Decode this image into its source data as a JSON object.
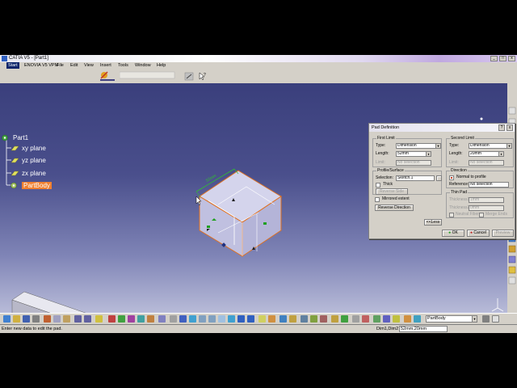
{
  "window": {
    "title": "CATIA V5 - [Part1]",
    "controls": [
      "_",
      "□",
      "x"
    ]
  },
  "menu": {
    "items": [
      "Start",
      "ENOVIA V5 VPM",
      "File",
      "Edit",
      "View",
      "Insert",
      "Tools",
      "Window",
      "Help"
    ]
  },
  "tree": {
    "root": "Part1",
    "planes": [
      "xy plane",
      "yz plane",
      "zx plane"
    ],
    "body": "PartBody"
  },
  "viewport": {
    "dimension_label": "52mm",
    "background_top": "#3a3f7c",
    "background_bottom": "#b8bbd8"
  },
  "dialog": {
    "title": "Pad Definition",
    "help": "?",
    "close": "x",
    "first_limit": {
      "group": "First Limit",
      "type_label": "Type:",
      "type_value": "Dimension",
      "length_label": "Length:",
      "length_value": "52mm",
      "limit_label": "Limit:",
      "limit_value": "No selection"
    },
    "profile": {
      "group": "Profile/Surface",
      "selection_label": "Selection:",
      "selection_value": "Sketch.1",
      "thick_label": "Thick",
      "reverse_side": "Reverse Side"
    },
    "mirrored_label": "Mirrored extent",
    "reverse_direction": "Reverse Direction",
    "second_limit": {
      "group": "Second Limit",
      "type_label": "Type:",
      "type_value": "Dimension",
      "length_label": "Length:",
      "length_value": "20mm",
      "limit_label": "Limit:",
      "limit_value": "No selection"
    },
    "direction": {
      "group": "Direction",
      "normal_label": "Normal to profile",
      "reference_label": "Reference:",
      "reference_value": "No selection"
    },
    "thin_pad": {
      "group": "Thin Pad",
      "thickness1_label": "Thickness1:",
      "thickness1_value": "1mm",
      "thickness2_label": "Thickness2:",
      "thickness2_value": "0mm",
      "neutral_label": "Neutral Fiber",
      "merge_label": "Merge Ends"
    },
    "less_button": "<<Less",
    "ok_button": "OK",
    "cancel_button": "Cancel",
    "preview_button": "Preview"
  },
  "bottom_toolbar": {
    "body_combo": "PartBody"
  },
  "status": {
    "message": "Enter new data to edit the pad.",
    "dim_label": "Dim1,Dim2",
    "dim_value": "52mm,20mm"
  },
  "colors": {
    "accent_orange": "#f08030",
    "cube_fill": "#c9c9e4",
    "cube_edge": "#e07020",
    "ui_gray": "#d4d0c8"
  }
}
